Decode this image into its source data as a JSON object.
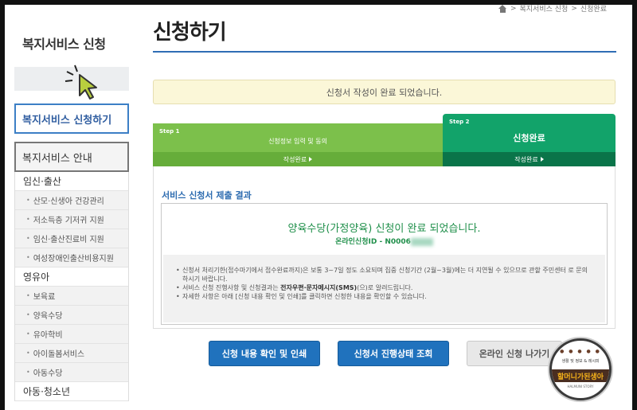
{
  "breadcrumb": {
    "items": [
      "복지서비스 신청",
      "신청완료"
    ],
    "separator": ">"
  },
  "sidebar": {
    "header_title": "복지서비스 신청",
    "active_item": "복지서비스 신청하기",
    "section_title": "복지서비스 안내",
    "groups": [
      {
        "label": "임신·출산",
        "items": [
          "산모·신생아 건강관리",
          "저소득층 기저귀 지원",
          "임신·출산진료비 지원",
          "여성장애인출산비용지원"
        ]
      },
      {
        "label": "영유아",
        "items": [
          "보육료",
          "양육수당",
          "유아학비",
          "아이돌봄서비스",
          "아동수당"
        ]
      },
      {
        "label": "아동·청소년",
        "items": []
      }
    ]
  },
  "page": {
    "title": "신청하기",
    "notice": "신청서 작성이 완료 되었습니다."
  },
  "steps": [
    {
      "num": "Step 1",
      "label": "신청정보 입력 및 동의",
      "status": "작성완료"
    },
    {
      "num": "Step 2",
      "label": "신청완료",
      "status": "작성완료"
    }
  ],
  "result": {
    "title": "서비스 신청서 제출 결과",
    "message": "양육수당(가정양육) 신청이 완료 되었습니다.",
    "app_id_label": "온라인신청ID - N0006",
    "notes": [
      "신청서 처리기한(접수마기에서 접수완료까지)은 보통 3~7일 정도 소요되며 집중 신청기간 (2월~3월)에는 더 지연될 수 있으므로 관할 주민센터 로 문의 하시기 바랍니다.",
      "서비스 신청 진행사항 및 신청결과는 |전자우편·문자메시지(SMS)|(으)로 알려드립니다.",
      "자세한 사항은 아래 [신청 내용 확인 및 인쇄]를 클릭하면 신청한 내용을 확인할 수 있습니다."
    ]
  },
  "buttons": {
    "print": "신청 내용 확인 및 인쇄",
    "status": "신청서 진행상태 조회",
    "exit": "온라인 신청 나가기"
  },
  "badge": {
    "text": "할머니가된생아",
    "top_text": "생활 및 정보 & 레시피",
    "sub_text": "HALMUNI STORY"
  },
  "colors": {
    "accent_blue": "#2072bd",
    "step1_green": "#7cc04b",
    "step2_green": "#12a36a",
    "success_text": "#1f8f4a"
  }
}
